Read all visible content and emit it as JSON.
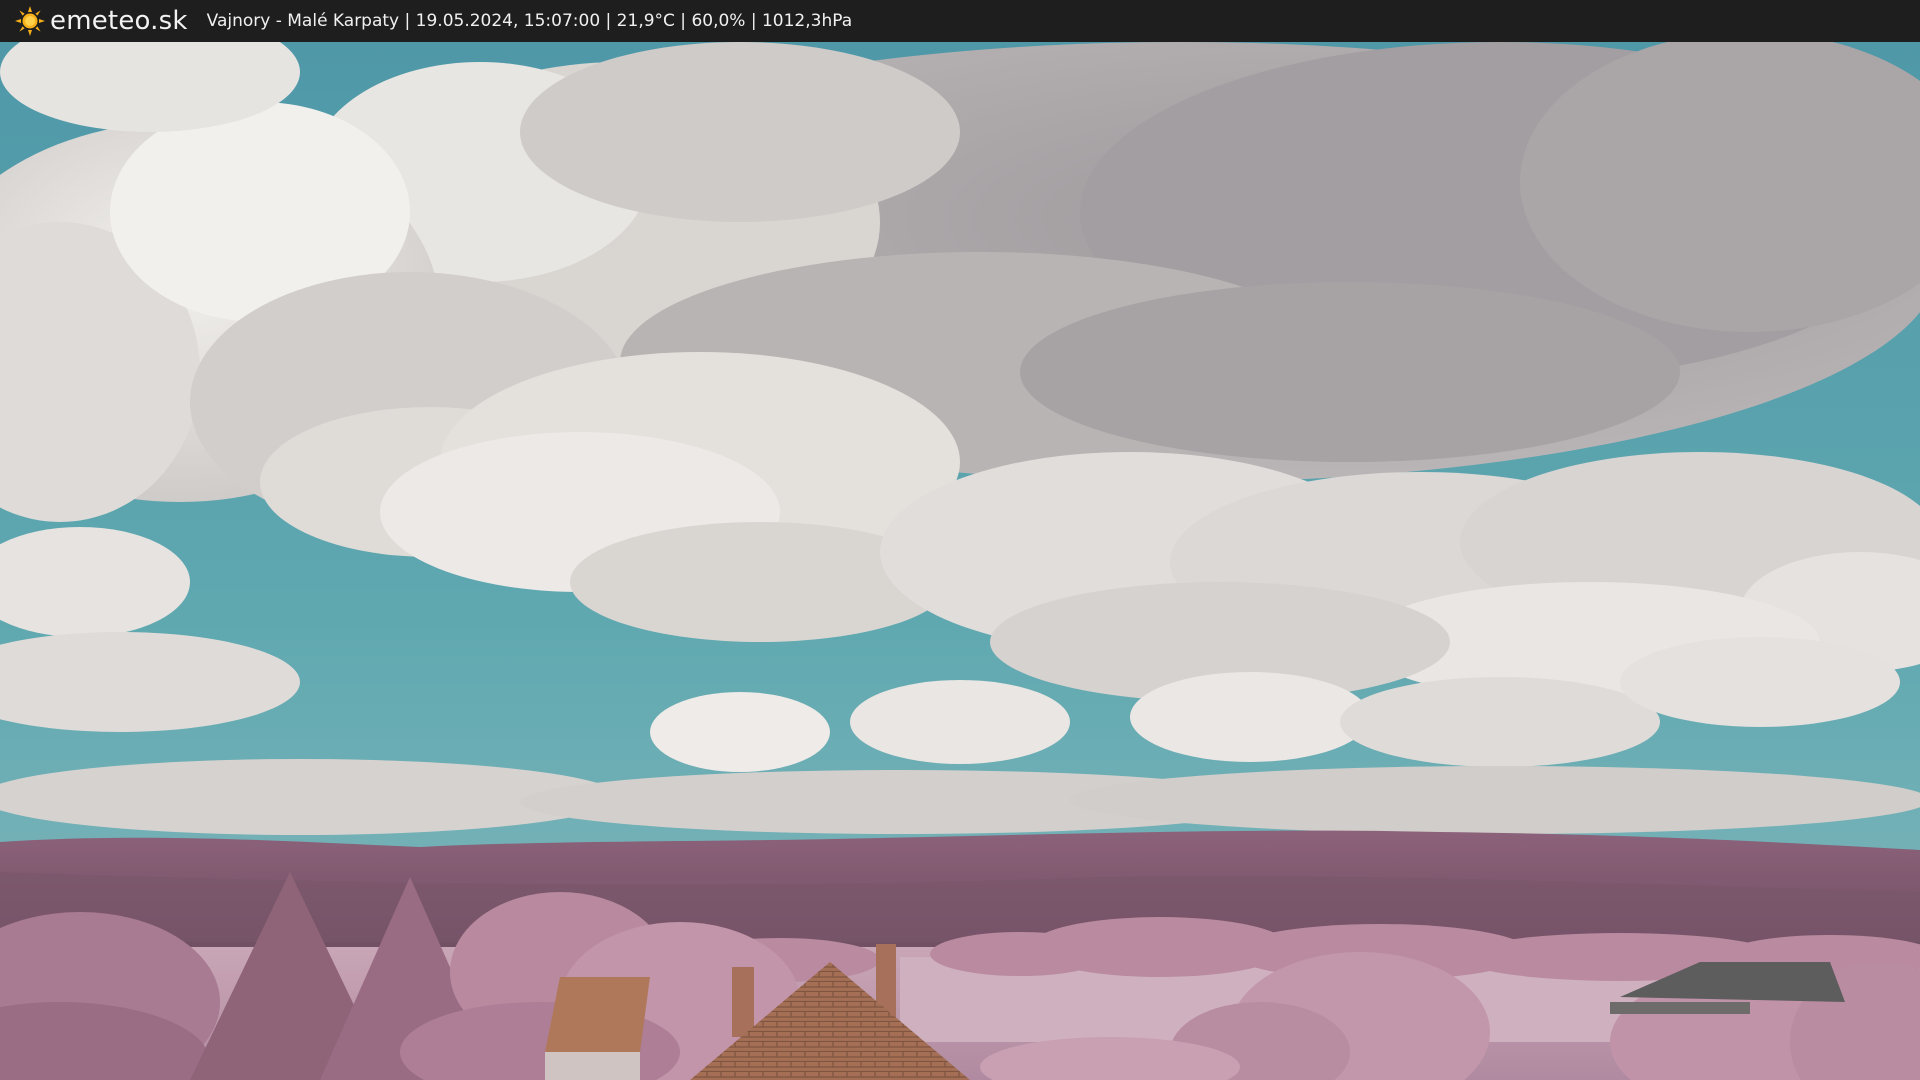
{
  "header": {
    "site_name": "emeteo.sk",
    "logo_icon": "sun-icon",
    "caption": "Vajnory - Malé Karpaty | 19.05.2024, 15:07:00 | 21,9°C | 60,0% | 1012,3hPa"
  },
  "colors": {
    "bar_background": "#1e1e1e",
    "sun_yellow": "#f6b01a",
    "sky_teal": "#5fa6af",
    "cloud_gray": "#a9a5a7",
    "foliage_pink": "#b9879e",
    "roof_brown": "#b0785a"
  }
}
